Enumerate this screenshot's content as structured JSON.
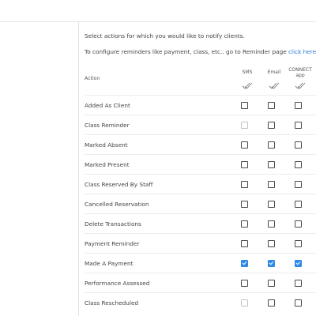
{
  "intro": {
    "line1": "Select actions for which you would like to notify clients.",
    "line2_prefix": "To configure reminders like payment, class, etc.. go to Reminder page ",
    "line2_link": "click here"
  },
  "table": {
    "action_header": "Action",
    "sms_header": "SMS",
    "email_header": "Email",
    "connect_header_line1": "CONNECT",
    "connect_header_line2": "app",
    "rows": [
      {
        "label": "Added As Client",
        "sms": false,
        "sms_disabled": false,
        "email": false,
        "connect": false
      },
      {
        "label": "Class Reminder",
        "sms": false,
        "sms_disabled": true,
        "email": false,
        "connect": false
      },
      {
        "label": "Marked Absent",
        "sms": false,
        "sms_disabled": false,
        "email": false,
        "connect": false
      },
      {
        "label": "Marked Present",
        "sms": false,
        "sms_disabled": false,
        "email": false,
        "connect": false
      },
      {
        "label": "Class Reserved By Staff",
        "sms": false,
        "sms_disabled": false,
        "email": false,
        "connect": false
      },
      {
        "label": "Cancelled Reservation",
        "sms": false,
        "sms_disabled": false,
        "email": false,
        "connect": false
      },
      {
        "label": "Delete Transactions",
        "sms": false,
        "sms_disabled": false,
        "email": false,
        "connect": false
      },
      {
        "label": "Payment Reminder",
        "sms": false,
        "sms_disabled": false,
        "email": false,
        "connect": false
      },
      {
        "label": "Made A Payment",
        "sms": true,
        "sms_disabled": false,
        "email": true,
        "connect": true
      },
      {
        "label": "Performance Assessed",
        "sms": false,
        "sms_disabled": false,
        "email": false,
        "connect": false
      },
      {
        "label": "Class Rescheduled",
        "sms": false,
        "sms_disabled": true,
        "email": false,
        "connect": false
      }
    ]
  },
  "colors": {
    "accent": "#2f8be8",
    "link": "#2a7ad6"
  },
  "icons": {
    "select_all": "double-check-icon"
  }
}
